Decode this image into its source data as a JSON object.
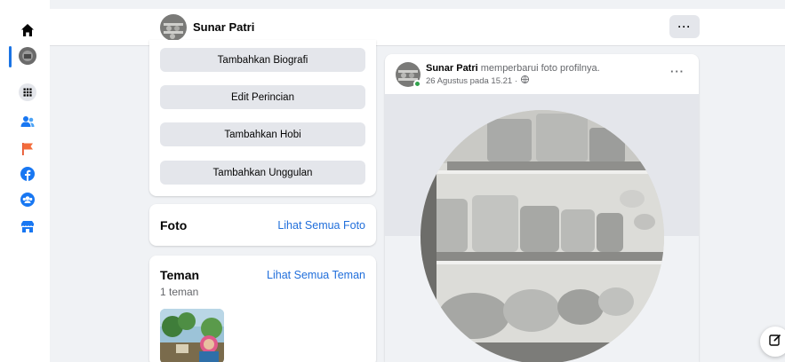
{
  "header": {
    "profile_name": "Sunar Patri",
    "more_label": "···"
  },
  "rail": {
    "icons": [
      "home-icon",
      "profile-avatar",
      "apps-grid-icon",
      "friends-icon",
      "pages-flag-icon",
      "facebook-icon",
      "groups-icon",
      "marketplace-icon"
    ],
    "accent": "#1b74e4"
  },
  "intro": {
    "buttons": [
      "Tambahkan Biografi",
      "Edit Perincian",
      "Tambahkan Hobi",
      "Tambahkan Unggulan"
    ]
  },
  "photos": {
    "title": "Foto",
    "link": "Lihat Semua Foto"
  },
  "friends": {
    "title": "Teman",
    "link": "Lihat Semua Teman",
    "count": "1 teman"
  },
  "post": {
    "author": "Sunar Patri",
    "action": " memperbarui foto profilnya.",
    "timestamp": "26 Agustus pada 15.21 ·",
    "more_label": "···"
  },
  "colors": {
    "link": "#216fdb",
    "online": "#31a24c",
    "background": "#f0f2f5"
  }
}
